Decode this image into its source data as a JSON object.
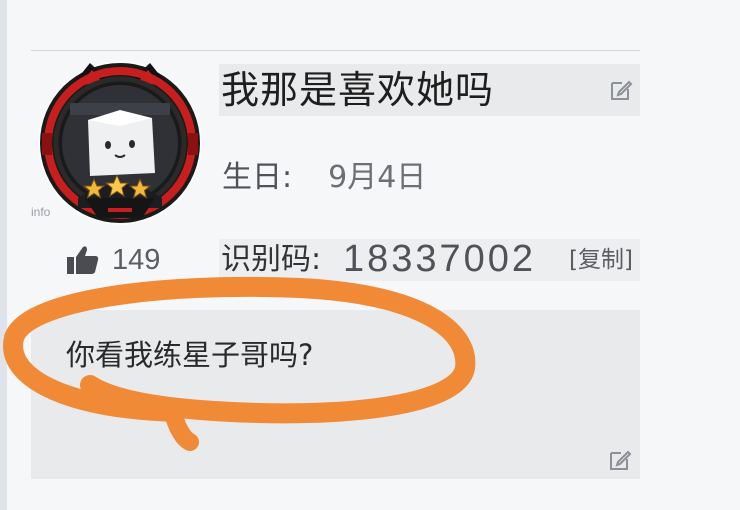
{
  "profile": {
    "nickname": "我那是喜欢她吗",
    "avatar_label": "info",
    "birthday_label": "生日:",
    "birthday_value": "9月4日",
    "like_count": "149",
    "id_label": "识别码:",
    "id_value": "18337002",
    "copy_label": "[复制]",
    "signature": "你看我练星子哥吗?"
  },
  "icons": {
    "edit": "edit-icon",
    "like": "thumbs-up-icon",
    "rank_badge": "three-gold-stars"
  },
  "colors": {
    "accent_red": "#c81e1e",
    "annotation_orange": "#f08a36",
    "star_gold": "#f2b83a"
  }
}
